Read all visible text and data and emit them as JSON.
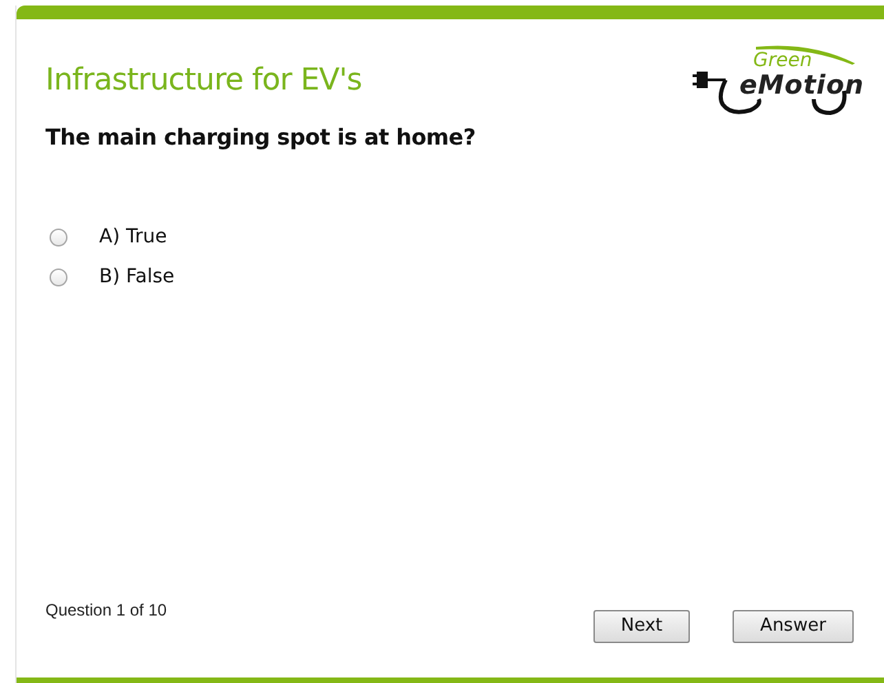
{
  "title": "Infrastructure for EV's",
  "logo": {
    "line_1": "Green",
    "line_2": "eMotion"
  },
  "question": "The main charging spot is at home?",
  "options": [
    {
      "label": "A) True",
      "selected": false
    },
    {
      "label": "B) False",
      "selected": false
    }
  ],
  "progress": "Question 1 of 10",
  "buttons": [
    "Next",
    "Answer"
  ]
}
